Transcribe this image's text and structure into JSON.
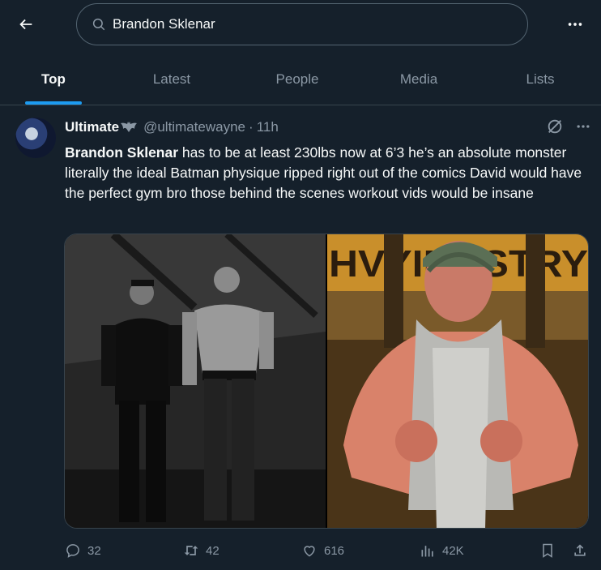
{
  "search": {
    "query": "Brandon Sklenar"
  },
  "tabs": [
    {
      "label": "Top",
      "active": true
    },
    {
      "label": "Latest",
      "active": false
    },
    {
      "label": "People",
      "active": false
    },
    {
      "label": "Media",
      "active": false
    },
    {
      "label": "Lists",
      "active": false
    }
  ],
  "tweet": {
    "name": "Ultimate",
    "handle": "@ultimatewayne",
    "separator": "·",
    "time": "11h",
    "text_bold": "Brandon Sklenar",
    "text_rest": " has to be at least 230lbs now at 6’3 he’s an absolute monster literally the ideal Batman physique ripped right out of the comics David would have the perfect gym bro those behind the scenes workout vids would be insane",
    "media_right_sign_text": "HVYINDSTRY",
    "stats": {
      "replies": "32",
      "reposts": "42",
      "likes": "616",
      "views": "42K"
    }
  },
  "colors": {
    "background": "#15202b",
    "accent": "#1d9bf0",
    "muted": "#8b98a5",
    "border": "#38444d"
  }
}
